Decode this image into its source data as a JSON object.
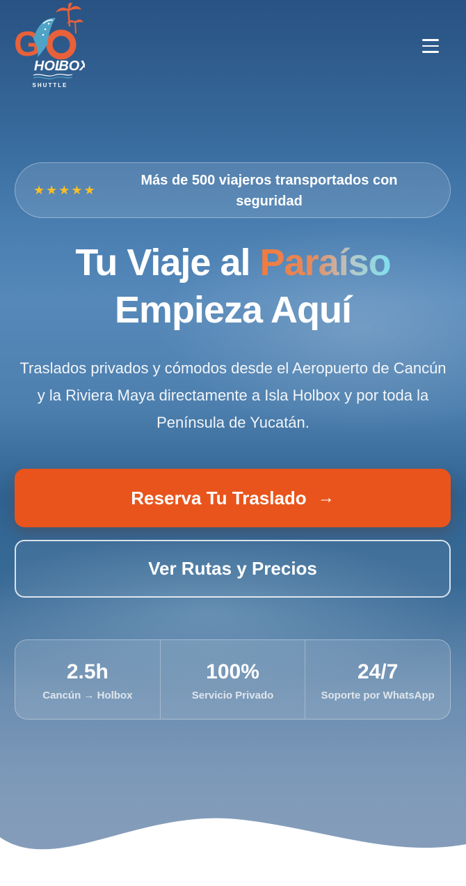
{
  "brand": {
    "logo_top": "GO",
    "logo_name": "HOL BOX",
    "logo_sub": "SHUTTLE"
  },
  "header": {
    "menu_icon": "hamburger-menu-icon"
  },
  "trust_badge": {
    "rating_stars": 5,
    "star_icon": "star-icon",
    "star_color": "#fbbf24",
    "text": "Más de 500 viajeros transportados con seguridad"
  },
  "hero": {
    "headline_part1": "Tu Viaje al ",
    "headline_accent": "Paraíso",
    "headline_line2": "Empieza Aquí",
    "subtitle": "Traslados privados y cómodos desde el Aeropuerto de Cancún y la Riviera Maya directamente a Isla Holbox y por toda la Península de Yucatán."
  },
  "actions": {
    "primary_label": "Reserva Tu Traslado",
    "primary_icon": "arrow-right-icon",
    "primary_color": "#e9541c",
    "secondary_label": "Ver Rutas y Precios"
  },
  "stats": [
    {
      "value": "2.5h",
      "label": "Cancún → Holbox"
    },
    {
      "value": "100%",
      "label": "Servicio Privado"
    },
    {
      "value": "24/7",
      "label": "Soporte por WhatsApp"
    }
  ],
  "colors": {
    "accent_orange": "#f07a3e",
    "accent_cyan": "#7ee0ee"
  }
}
